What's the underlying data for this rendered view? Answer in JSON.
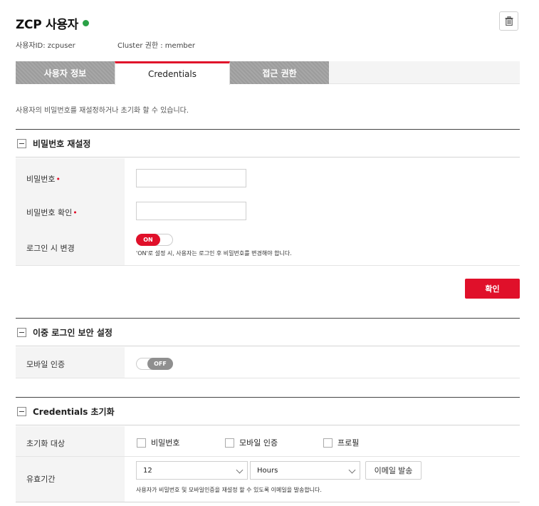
{
  "header": {
    "title": "ZCP 사용자",
    "status_color": "#2aa146",
    "user_id": "사용자ID: zcpuser",
    "cluster_role": "Cluster 권한 : member",
    "delete_icon": "trash-icon"
  },
  "tabs": [
    {
      "label": "사용자 정보",
      "active": false
    },
    {
      "label": "Credentials",
      "active": true
    },
    {
      "label": "접근 권한",
      "active": false
    }
  ],
  "description": "사용자의 비밀번호를 재설정하거나 초기화 할 수 있습니다.",
  "password_section": {
    "title": "비밀번호 재설정",
    "password_label": "비밀번호",
    "password_value": "",
    "confirm_label": "비밀번호 확인",
    "confirm_value": "",
    "change_on_login_label": "로그인 시 변경",
    "change_on_login_state": "ON",
    "change_on_login_hint": "'ON'로 설정 시, 사용자는 로그인 후 비밀번호를 변경해야 합니다.",
    "confirm_button": "확인"
  },
  "two_factor_section": {
    "title": "이중 로그인 보안 설정",
    "mobile_auth_label": "모바일 인증",
    "mobile_auth_state": "OFF"
  },
  "reset_section": {
    "title": "Credentials 초기화",
    "target_label": "초기화 대상",
    "targets": [
      "비밀번호",
      "모바일 인증",
      "프로필"
    ],
    "validity_label": "유효기간",
    "validity_value": "12",
    "validity_unit": "Hours",
    "email_button": "이메일 발송",
    "hint": "사용자가 비밀번호 및 모바일인증을 재설정 할 수 있도록 이메일을 발송합니다."
  },
  "colors": {
    "accent": "#e0102a",
    "tab_inactive": "#a7a7a7",
    "label_bg": "#f4f4f4"
  }
}
